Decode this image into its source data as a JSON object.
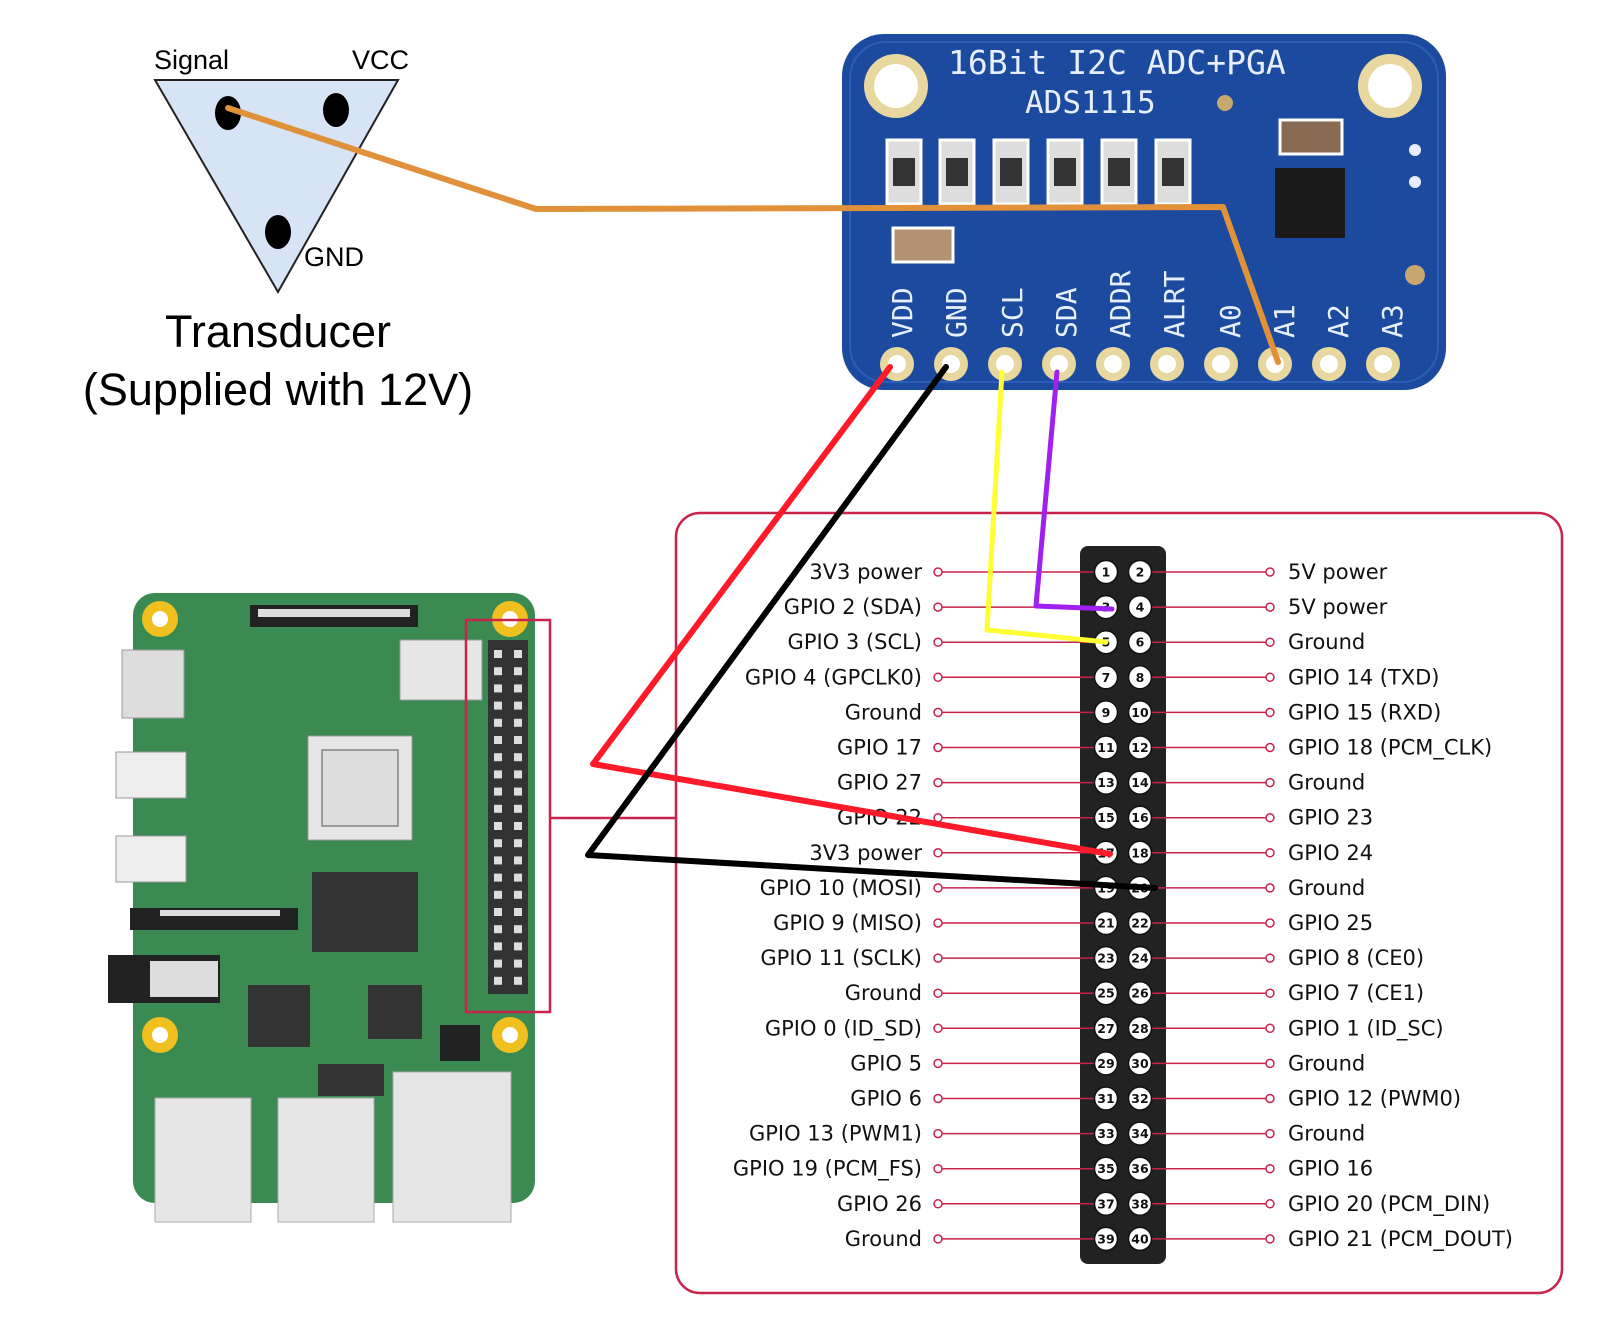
{
  "transducer": {
    "signal_label": "Signal",
    "vcc_label": "VCC",
    "gnd_label": "GND",
    "title_line1": "Transducer",
    "title_line2": "(Supplied with 12V)"
  },
  "adc_board": {
    "title_line1": "16Bit I2C ADC+PGA",
    "title_line2": "ADS1115",
    "pins": [
      "VDD",
      "GND",
      "SCL",
      "SDA",
      "ADDR",
      "ALRT",
      "A0",
      "A1",
      "A2",
      "A3"
    ],
    "color": "#1b4a9e"
  },
  "header_pins": {
    "left_labels": [
      "3V3 power",
      "GPIO 2 (SDA)",
      "GPIO 3 (SCL)",
      "GPIO 4 (GPCLK0)",
      "Ground",
      "GPIO 17",
      "GPIO 27",
      "GPIO 22",
      "3V3 power",
      "GPIO 10 (MOSI)",
      "GPIO 9 (MISO)",
      "GPIO 11 (SCLK)",
      "Ground",
      "GPIO 0 (ID_SD)",
      "GPIO 5",
      "GPIO 6",
      "GPIO 13 (PWM1)",
      "GPIO 19 (PCM_FS)",
      "GPIO 26",
      "Ground"
    ],
    "right_labels": [
      "5V power",
      "5V power",
      "Ground",
      "GPIO 14 (TXD)",
      "GPIO 15 (RXD)",
      "GPIO 18 (PCM_CLK)",
      "Ground",
      "GPIO 23",
      "GPIO 24",
      "Ground",
      "GPIO 25",
      "GPIO 8 (CE0)",
      "GPIO 7 (CE1)",
      "GPIO 1 (ID_SC)",
      "Ground",
      "GPIO 12 (PWM0)",
      "Ground",
      "GPIO 16",
      "GPIO 20 (PCM_DIN)",
      "GPIO 21 (PCM_DOUT)"
    ],
    "odd_numbers": [
      "1",
      "3",
      "5",
      "7",
      "9",
      "11",
      "13",
      "15",
      "17",
      "19",
      "21",
      "23",
      "25",
      "27",
      "29",
      "31",
      "33",
      "35",
      "37",
      "39"
    ],
    "even_numbers": [
      "2",
      "4",
      "6",
      "8",
      "10",
      "12",
      "14",
      "16",
      "18",
      "20",
      "22",
      "24",
      "26",
      "28",
      "30",
      "32",
      "34",
      "36",
      "38",
      "40"
    ],
    "accent_color": "#c8234a"
  },
  "wires": {
    "signal_color": "#e0913a",
    "vdd_color": "#ff1a2a",
    "gnd_color": "#000000",
    "scl_color": "#ffff33",
    "sda_color": "#a020f0"
  },
  "raspberry_pi": {
    "board_color": "#3a8a52"
  }
}
